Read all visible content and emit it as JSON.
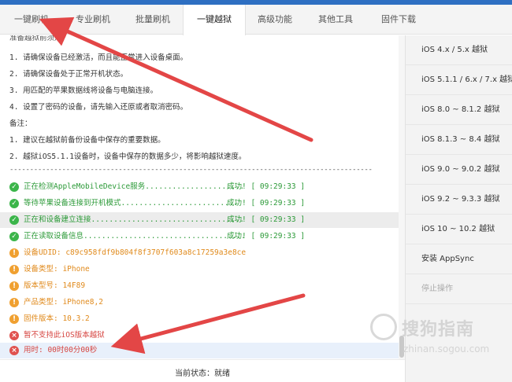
{
  "top_tabs": [
    {
      "label": "一键刷机",
      "active": false
    },
    {
      "label": "专业刷机",
      "active": false
    },
    {
      "label": "批量刷机",
      "active": false
    },
    {
      "label": "一键越狱",
      "active": true
    },
    {
      "label": "高级功能",
      "active": false
    },
    {
      "label": "其他工具",
      "active": false
    },
    {
      "label": "固件下载",
      "active": false
    }
  ],
  "notes": {
    "cut_line": "准备越狱前须知",
    "items": [
      "1. 请确保设备已经激活，而且能正常进入设备桌面。",
      "2. 请确保设备处于正常开机状态。",
      "3. 用匹配的苹果数据线将设备与电脑连接。",
      "4. 设置了密码的设备，请先输入还原或者取消密码。",
      "备注：",
      "1. 建议在越狱前备份设备中保存的重要数据。",
      "2. 越狱iOS5.1.1设备时，设备中保存的数据多少，将影响越狱速度。"
    ],
    "divider": "------------------------------------------------------------------------------------------"
  },
  "log": [
    {
      "type": "ok",
      "text": "正在检测AppleMobileDevice服务......................",
      "result": "成功! [ 09:29:33 ]"
    },
    {
      "type": "ok",
      "text": "等待苹果设备连接到开机模式..........................",
      "result": "成功! [ 09:29:33 ]"
    },
    {
      "type": "ok",
      "text": "正在和设备建立连接..................................",
      "result": "成功! [ 09:29:33 ]"
    },
    {
      "type": "ok",
      "text": "正在读取设备信息....................................",
      "result": "成功! [ 09:29:33 ]"
    },
    {
      "type": "warn",
      "text": "设备UDID: c89c958fdf9b804f8f3707f603a8c17259a3e8ce",
      "result": ""
    },
    {
      "type": "warn",
      "text": "设备类型: iPhone",
      "result": ""
    },
    {
      "type": "warn",
      "text": "版本型号: 14F89",
      "result": ""
    },
    {
      "type": "warn",
      "text": "产品类型: iPhone8,2",
      "result": ""
    },
    {
      "type": "warn",
      "text": "固件版本: 10.3.2",
      "result": ""
    },
    {
      "type": "err",
      "text": "暂不支持此iOS版本越狱",
      "result": ""
    },
    {
      "type": "err",
      "text": "用时: 00时00分00秒",
      "result": ""
    }
  ],
  "status": {
    "label": "当前状态：就绪"
  },
  "side_buttons": [
    {
      "label": "iOS 4.x / 5.x 越狱",
      "enabled": true
    },
    {
      "label": "iOS 5.1.1 / 6.x / 7.x 越狱",
      "enabled": true
    },
    {
      "label": "iOS 8.0 ~ 8.1.2 越狱",
      "enabled": true
    },
    {
      "label": "iOS 8.1.3 ~ 8.4 越狱",
      "enabled": true
    },
    {
      "label": "iOS 9.0 ~ 9.0.2 越狱",
      "enabled": true
    },
    {
      "label": "iOS 9.2 ~ 9.3.3 越狱",
      "enabled": true
    },
    {
      "label": "iOS 10 ~ 10.2 越狱",
      "enabled": true
    },
    {
      "label": "安装 AppSync",
      "enabled": true
    },
    {
      "label": "停止操作",
      "enabled": false
    }
  ],
  "watermark": {
    "brand": "搜狗指南",
    "url": "zhinan.sogou.com"
  },
  "colors": {
    "success": "#2c9a38",
    "warning": "#e08a1c",
    "error": "#d64541",
    "arrow": "#e34646"
  }
}
